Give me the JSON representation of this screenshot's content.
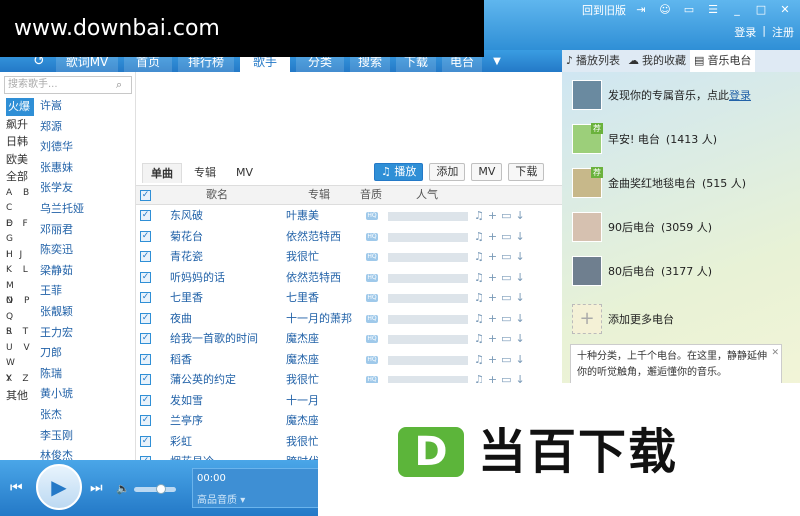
{
  "watermark": "www.downbai.com",
  "titlebar": {
    "back_to_old": "回到旧版",
    "login": "登录",
    "register": "注册"
  },
  "nav": {
    "tabs": [
      {
        "label": "歌词MV",
        "active": false
      },
      {
        "label": "首页",
        "active": false
      },
      {
        "label": "排行榜",
        "active": false
      },
      {
        "label": "歌手",
        "active": true
      },
      {
        "label": "分类",
        "active": false
      },
      {
        "label": "搜索",
        "active": false
      },
      {
        "label": "下载",
        "active": false
      },
      {
        "label": "电台",
        "active": false
      }
    ]
  },
  "right_tabs": [
    {
      "label": "播放列表",
      "icon": "music-note-icon",
      "active": false
    },
    {
      "label": "我的收藏",
      "icon": "cloud-icon",
      "active": false
    },
    {
      "label": "音乐电台",
      "icon": "radio-icon",
      "active": true
    }
  ],
  "sidebar": {
    "search_placeholder": "搜索歌手...",
    "categories": [
      "火爆",
      "飙升",
      "日韩",
      "欧美",
      "全部"
    ],
    "letters": [
      "A B",
      "C D",
      "E F",
      "G H",
      "I J",
      "K L",
      "M N",
      "O P",
      "Q R",
      "S T",
      "U V",
      "W X",
      "Y Z"
    ],
    "other": "其他",
    "artists": [
      "许嵩",
      "郑源",
      "刘德华",
      "张惠妹",
      "张学友",
      "乌兰托娅",
      "邓丽君",
      "陈奕迅",
      "梁静茹",
      "王菲",
      "张靓颖",
      "王力宏",
      "刀郎",
      "陈瑞",
      "黄小琥",
      "张杰",
      "李玉刚",
      "林俊杰"
    ]
  },
  "content": {
    "subtabs": [
      "单曲",
      "专辑",
      "MV"
    ],
    "actions": {
      "play": "播放",
      "add": "添加",
      "mv": "MV",
      "download": "下载"
    },
    "columns": {
      "song": "歌名",
      "album": "专辑",
      "quality": "音质",
      "popularity": "人气"
    },
    "rows": [
      {
        "song": "东风破",
        "album": "叶惠美"
      },
      {
        "song": "菊花台",
        "album": "依然范特西"
      },
      {
        "song": "青花瓷",
        "album": "我很忙"
      },
      {
        "song": "听妈妈的话",
        "album": "依然范特西"
      },
      {
        "song": "七里香",
        "album": "七里香"
      },
      {
        "song": "夜曲",
        "album": "十一月的萧邦"
      },
      {
        "song": "给我一首歌的时间",
        "album": "魔杰座"
      },
      {
        "song": "稻香",
        "album": "魔杰座"
      },
      {
        "song": "蒲公英的约定",
        "album": "我很忙"
      },
      {
        "song": "发如雪",
        "album": "十一月"
      },
      {
        "song": "兰亭序",
        "album": "魔杰座"
      },
      {
        "song": "彩虹",
        "album": "我很忙"
      },
      {
        "song": "烟花易冷",
        "album": "跨时代"
      }
    ]
  },
  "radio": {
    "discover_text": "发现你的专属音乐，点此",
    "discover_link": "登录",
    "stations": [
      {
        "name": "早安! 电台",
        "count": "(1413 人)",
        "badge": "荐"
      },
      {
        "name": "金曲奖红地毯电台",
        "count": "(515 人)",
        "badge": "荐"
      },
      {
        "name": "90后电台",
        "count": "(3059 人)",
        "badge": ""
      },
      {
        "name": "80后电台",
        "count": "(3177 人)",
        "badge": ""
      }
    ],
    "add_more": "添加更多电台",
    "intro": "十种分类，上千个电台。在这里，静静延伸你的听觉触角，邂逅懂你的音乐。"
  },
  "player": {
    "time": "00:00",
    "quality": "高品音质"
  },
  "logo": {
    "letter": "D",
    "text": "当百下载"
  }
}
